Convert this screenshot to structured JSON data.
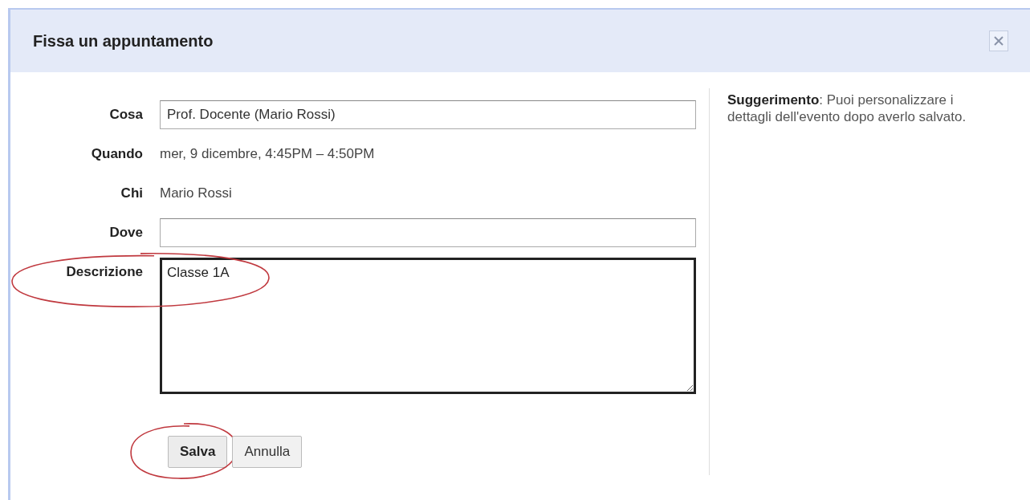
{
  "dialog": {
    "title": "Fissa un appuntamento"
  },
  "fields": [
    {
      "kind": "input",
      "label": "Cosa",
      "value": "Prof. Docente (Mario Rossi)",
      "highlighted": false
    },
    {
      "kind": "text",
      "label": "Quando",
      "value": "mer, 9 dicembre, 4:45PM – 4:50PM",
      "highlighted": false
    },
    {
      "kind": "text",
      "label": "Chi",
      "value": "Mario Rossi",
      "highlighted": false
    },
    {
      "kind": "input",
      "label": "Dove",
      "highlighted": false
    },
    {
      "kind": "textarea",
      "label": "Descrizione",
      "value": "Classe 1A",
      "highlighted": true,
      "focused": true
    }
  ],
  "buttons": [
    {
      "label": "Salva",
      "primary": true,
      "highlighted": true
    },
    {
      "label": "Annulla",
      "primary": false,
      "highlighted": false
    }
  ],
  "tip": "**Suggerimento**: Puoi personalizzare i dettagli dell'evento dopo averlo salvato."
}
